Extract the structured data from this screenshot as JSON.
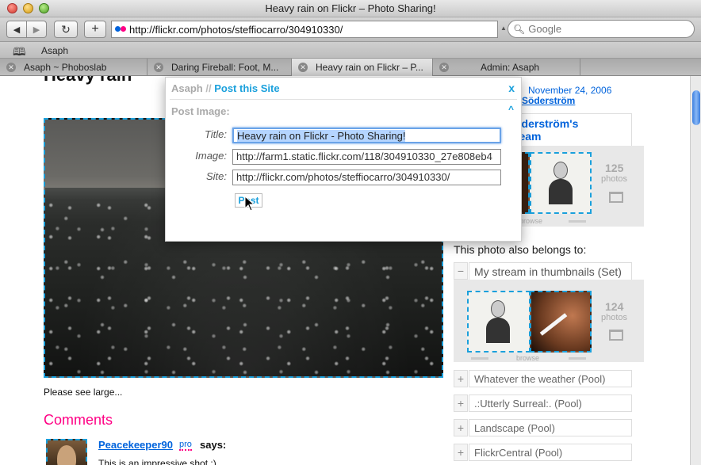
{
  "window": {
    "title": "Heavy rain on Flickr – Photo Sharing!"
  },
  "toolbar": {
    "back_icon": "◀",
    "forward_icon": "▶",
    "reload_icon": "↻",
    "add_icon": "+",
    "url": "http://flickr.com/photos/steffiocarro/304910330/",
    "search_placeholder": "Google"
  },
  "bookmarks": {
    "icon": "book-icon",
    "items": [
      "Asaph"
    ]
  },
  "tabs": [
    {
      "label": "Asaph ~ Phoboslab",
      "active": false
    },
    {
      "label": "Daring Fireball: Foot, M...",
      "active": false
    },
    {
      "label": "Heavy rain on Flickr – P...",
      "active": true
    },
    {
      "label": "Admin: Asaph",
      "active": false
    }
  ],
  "page": {
    "photo_title": "Heavy rain",
    "see_large": "Please see large...",
    "comments_heading": "Comments",
    "comment": {
      "author": "Peacekeeper90",
      "badge": "pro",
      "says": "says:",
      "text": "This is an impressive shot :)"
    },
    "uploaded": "November 24, 2006",
    "uploader": "Söderström",
    "stream_title": "öderström's\nream",
    "stream_count": "125",
    "stream_count_label": "photos",
    "browse": "browse",
    "belongs_heading": "This photo also belongs to:",
    "set_toggle": "−",
    "set_title": "My stream in thumbnails (Set)",
    "set_count": "124",
    "set_count_label": "photos",
    "pools": [
      {
        "toggle": "+",
        "title": "Whatever the weather (Pool)"
      },
      {
        "toggle": "+",
        "title": ".:Utterly Surreal:. (Pool)"
      },
      {
        "toggle": "+",
        "title": "Landscape (Pool)"
      },
      {
        "toggle": "+",
        "title": "FlickrCentral (Pool)"
      }
    ]
  },
  "overlay": {
    "brand": "Asaph",
    "separator": "//",
    "header_link": "Post this Site",
    "close": "x",
    "section": "Post Image:",
    "collapse": "^",
    "title_label": "Title:",
    "title_value": "Heavy rain on Flickr - Photo Sharing!",
    "image_label": "Image:",
    "image_value": "http://farm1.static.flickr.com/118/304910330_27e808eb4",
    "site_label": "Site:",
    "site_value": "http://flickr.com/photos/steffiocarro/304910330/",
    "post_button": "Post"
  },
  "colors": {
    "accent": "#1aa0dc",
    "flickr_pink": "#ff0084",
    "flickr_blue": "#0063dc"
  }
}
